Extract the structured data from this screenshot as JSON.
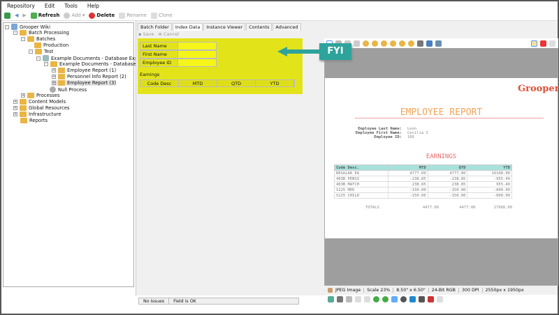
{
  "menu": [
    "Repository",
    "Edit",
    "Tools",
    "Help"
  ],
  "toolbar": {
    "refresh": "Refresh",
    "add": "Add",
    "delete": "Delete",
    "rename": "Rename",
    "clone": "Clone"
  },
  "tree": [
    "Grooper Wiki",
    "Batch Processing",
    "Batches",
    "Production",
    "Test",
    "Example Documents - Database Export",
    "Example Documents - Database Export",
    "Employee Report (1)",
    "Personnel Info Report (2)",
    "Employee Report (3)",
    "Null Process",
    "Processes",
    "Content Models",
    "Global Resources",
    "Infrastructure",
    "Reports"
  ],
  "tabs": [
    "Batch Folder",
    "Index Data",
    "Instance Viewer",
    "Contents",
    "Advanced"
  ],
  "actions": {
    "save": "Save",
    "cancel": "Cancel"
  },
  "fields": [
    "Last Name",
    "First Name",
    "Employee ID"
  ],
  "earnings": {
    "label": "Earnings",
    "columns": [
      "Code Desc",
      "MTD",
      "QTD",
      "YTD"
    ]
  },
  "callout": "FYI",
  "highlight_color": "#e3e31a",
  "document": {
    "logo": "Grooper",
    "title": "EMPLOYEE REPORT",
    "info": [
      {
        "label": "Employee Last Name:",
        "value": "Leon"
      },
      {
        "label": "Employee First Name:",
        "value": "Cecilia I"
      },
      {
        "label": "Employee ID:",
        "value": "166"
      }
    ],
    "section": "EARNINGS",
    "columns": [
      "Code Desc.",
      "MTD",
      "QTD",
      "YTD"
    ],
    "rows": [
      [
        "REGULAR EA",
        "4777.00",
        "4777.00",
        "19108.00"
      ],
      [
        "403B PENSI",
        "-238.85",
        "-238.85",
        "-955.40"
      ],
      [
        "403B MATCH",
        "238.85",
        "238.85",
        "955.40"
      ],
      [
        "S125 MED",
        "-150.00",
        "-150.00",
        "-600.00"
      ],
      [
        "S125 CHILD",
        "-150.00",
        "-150.00",
        "-600.00"
      ]
    ],
    "totals": [
      "TOTALS",
      "4477.00",
      "4477.00",
      "17908.00"
    ]
  },
  "viewer_status": [
    "JPEG Image",
    "Scale 23%",
    "8.50\" x 6.50\"",
    "24-Bit RGB",
    "300 DPI",
    "2550px x 1950px"
  ],
  "status": {
    "issues": "No Issues",
    "message": "Field is OK"
  }
}
